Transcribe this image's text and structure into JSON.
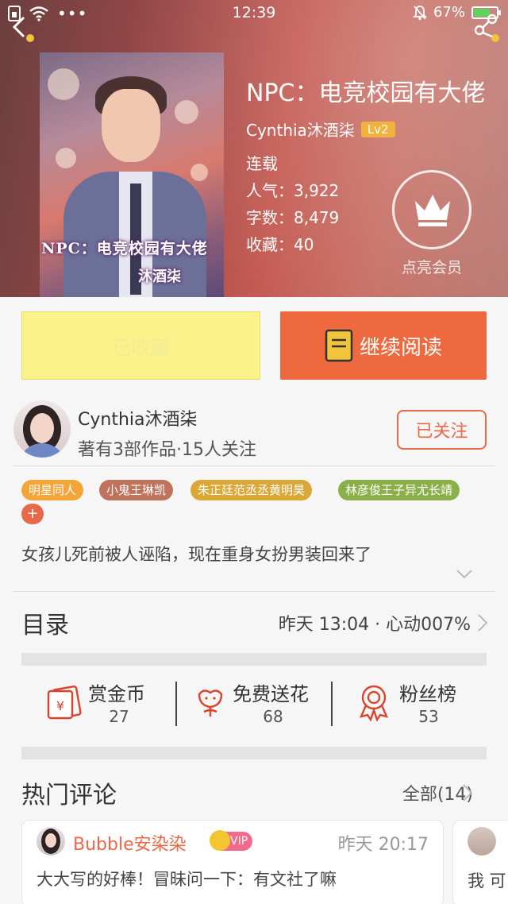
{
  "status_bar": {
    "time": "12:39",
    "battery": "67%",
    "icons": [
      "sim-icon",
      "wifi-icon",
      "more-icon",
      "mute-icon",
      "battery-icon"
    ]
  },
  "book": {
    "title": "NPC：电竞校园有大佬",
    "cover_title": "NPC：电竞校园有大佬",
    "cover_author": "沐酒柒",
    "author": "Cynthia沐酒柒",
    "level": "Lv2",
    "status": "连载",
    "popularity": "人气：3,922",
    "words": "字数：8,479",
    "favorites": "收藏：40"
  },
  "vip": {
    "label": "点亮会员"
  },
  "actions": {
    "favorited_label": "已收藏",
    "continue_label": "继续阅读"
  },
  "author_block": {
    "name": "Cynthia沐酒柒",
    "meta": "著有3部作品·15人关注",
    "follow_label": "已关注"
  },
  "tags": [
    {
      "label": "明星同人",
      "color": "#f2a63a"
    },
    {
      "label": "小鬼王琳凯",
      "color": "#c0735c"
    },
    {
      "label": "朱正廷范丞丞黄明昊",
      "color": "#d9a836"
    },
    {
      "label": "林彦俊王子异尤长靖",
      "color": "#8bb04a"
    }
  ],
  "tag_more": "+",
  "summary": "女孩儿死前被人诬陷，现在重身女扮男装回来了",
  "toc": {
    "title": "目录",
    "latest": "昨天 13:04 · 心动007%"
  },
  "stats": [
    {
      "label": "赏金币",
      "value": "27",
      "icon": "gold-coin-icon"
    },
    {
      "label": "免费送花",
      "value": "68",
      "icon": "flower-icon"
    },
    {
      "label": "粉丝榜",
      "value": "53",
      "icon": "medal-icon"
    }
  ],
  "hot_comments": {
    "title": "热门评论",
    "all_label": "全部(14)",
    "items": [
      {
        "user": "Bubble安染染",
        "badge": "VIP",
        "time": "昨天 20:17",
        "text": "大大写的好棒！冒昧问一下：有文社了嘛"
      },
      {
        "text": "我 可"
      }
    ]
  },
  "colors": {
    "accent": "#ee6a3e",
    "fav_bg": "#fbf28a",
    "follow": "#e8694a"
  }
}
